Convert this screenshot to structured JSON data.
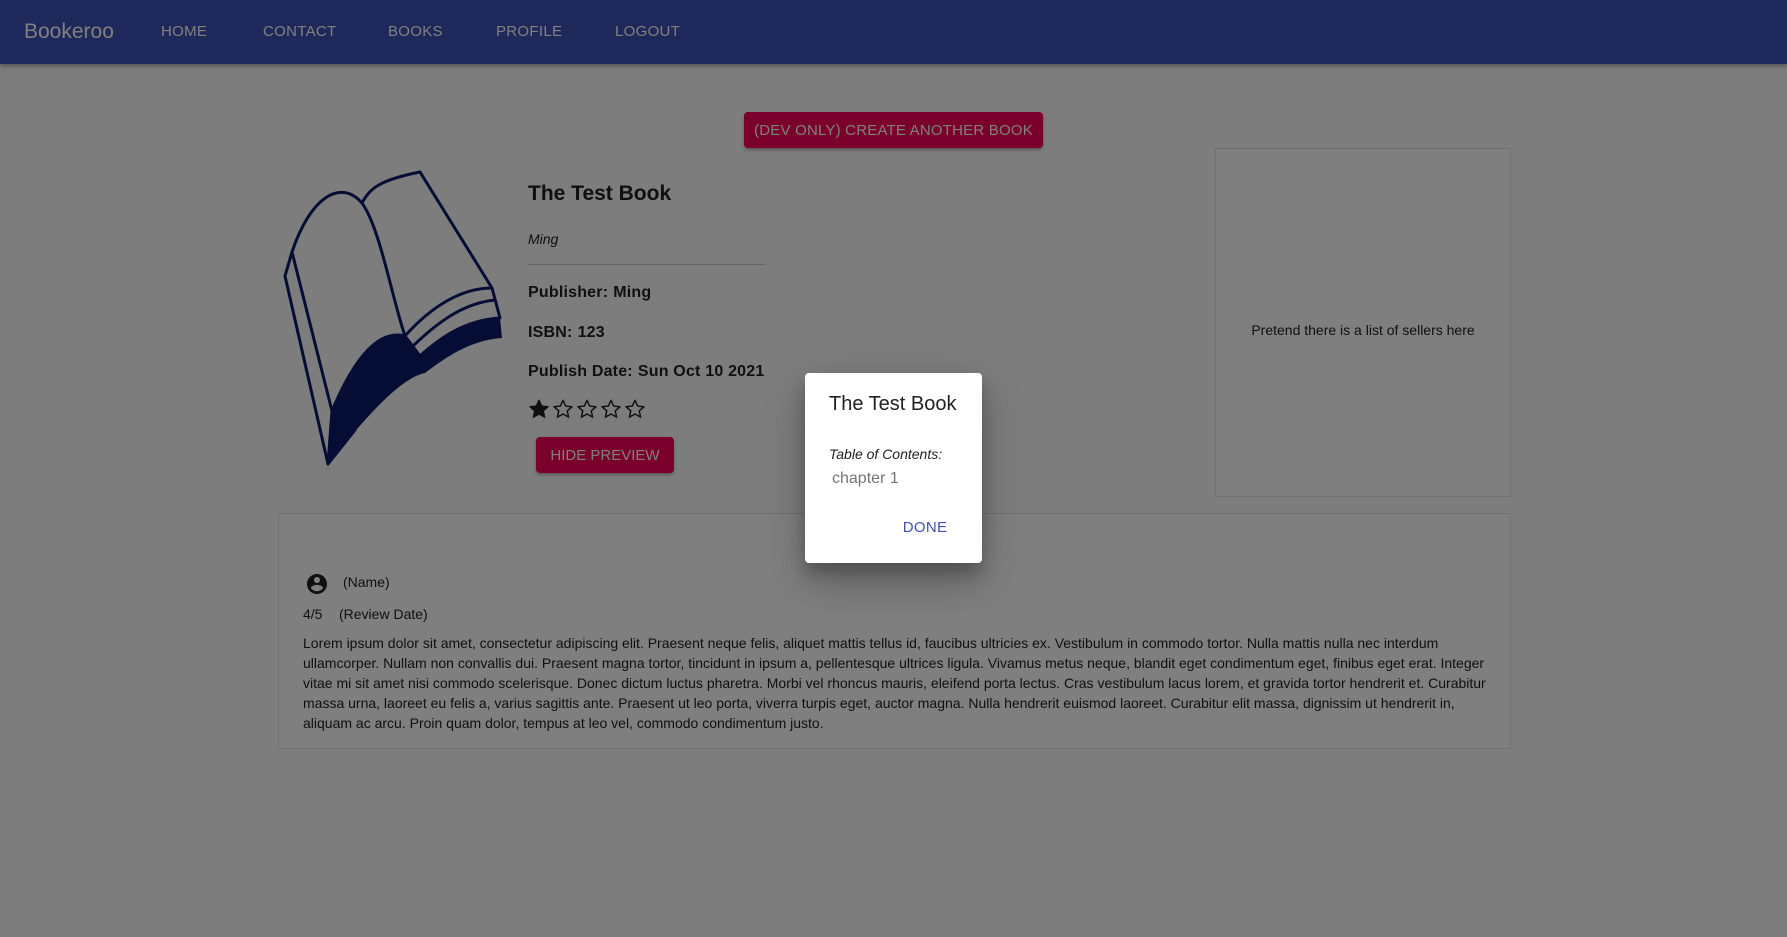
{
  "app": {
    "brand": "Bookeroo",
    "nav": [
      {
        "label": "HOME"
      },
      {
        "label": "CONTACT"
      },
      {
        "label": "BOOKS"
      },
      {
        "label": "PROFILE"
      },
      {
        "label": "LOGOUT"
      }
    ]
  },
  "page": {
    "create_button": "(DEV ONLY) CREATE ANOTHER BOOK",
    "book": {
      "cover_icon": "open-book-icon",
      "title": "The Test Book",
      "author": "Ming",
      "publisher_label": "Publisher:",
      "publisher": "Ming",
      "isbn_label": "ISBN:",
      "isbn": "123",
      "publish_date_label": "Publish Date:",
      "publish_date": "Sun Oct 10 2021",
      "rating": 1,
      "rating_max": 5
    },
    "hide_preview_button": "HIDE PREVIEW",
    "sellers_placeholder": "Pretend there is a list of sellers here",
    "review": {
      "avatar_icon": "account-circle-icon",
      "name": "(Name)",
      "rating": "4/5",
      "date": "(Review Date)",
      "body": "Lorem ipsum dolor sit amet, consectetur adipiscing elit. Praesent neque felis, aliquet mattis tellus id, faucibus ultricies ex. Vestibulum in commodo tortor. Nulla mattis nulla nec interdum ullamcorper. Nullam non convallis dui. Praesent magna tortor, tincidunt in ipsum a, pellentesque ultrices ligula. Vivamus metus neque, blandit eget condimentum eget, finibus eget erat. Integer vitae mi sit amet nisi commodo scelerisque. Donec dictum luctus pharetra. Morbi vel rhoncus mauris, eleifend porta lectus. Cras vestibulum lacus lorem, et gravida tortor hendrerit et. Curabitur massa urna, laoreet eu felis a, varius sagittis ante. Praesent ut leo porta, viverra turpis eget, auctor magna. Nulla hendrerit euismod laoreet. Curabitur elit massa, dignissim ut hendrerit in, aliquam ac arcu. Proin quam dolor, tempus at leo vel, commodo condimentum justo."
    }
  },
  "dialog": {
    "title": "The Test Book",
    "toc_label": "Table of Contents:",
    "toc_items": [
      "chapter 1"
    ],
    "done_button": "DONE"
  },
  "colors": {
    "primary": "#3f51b5",
    "secondary": "#f50057",
    "backdrop": "rgba(0,0,0,0.5)"
  }
}
